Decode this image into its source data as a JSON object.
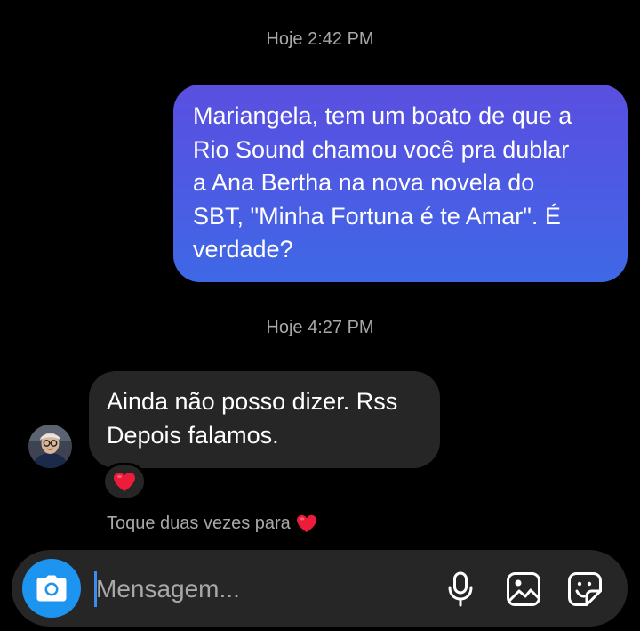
{
  "thread": {
    "timestamp_1": "Hoje 2:42 PM",
    "timestamp_2": "Hoje 4:27 PM",
    "outgoing_message": {
      "lines": [
        "Mariangela, tem um boato de que a",
        "Rio Sound chamou você pra dublar",
        "a Ana Bertha na nova novela do",
        "SBT, \"Minha Fortuna é te Amar\". É",
        "verdade?"
      ]
    },
    "incoming_message": {
      "lines": [
        "Ainda não posso dizer. Rss",
        "Depois falamos."
      ],
      "reaction": "heart-emoji"
    },
    "double_tap_hint": "Toque duas vezes para"
  },
  "composer": {
    "placeholder": "Mensagem...",
    "value": "",
    "icons": [
      "camera-icon",
      "microphone-icon",
      "gallery-icon",
      "sticker-icon"
    ]
  },
  "colors": {
    "background": "#000000",
    "outgoing_bubble_top": "#5a4fe0",
    "outgoing_bubble_bottom": "#3e68e6",
    "incoming_bubble": "#262626",
    "camera_button": "#1d95f0",
    "heart": "#ed1c3a",
    "secondary_text": "#a8a8a8"
  }
}
